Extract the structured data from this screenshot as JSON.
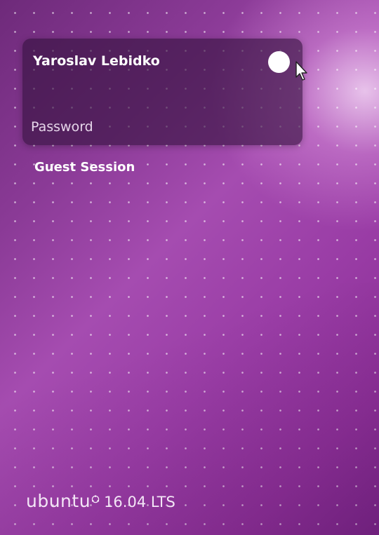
{
  "login": {
    "user_name": "Yaroslav Lebidko",
    "password_placeholder": "Password",
    "guest_session_label": "Guest Session"
  },
  "footer": {
    "logo_text": "ubuntu",
    "version": "16.04 LTS"
  },
  "icons": {
    "session_toggle": "white-circle-toggle",
    "cursor": "mouse-pointer-icon",
    "logo_mark": "ubuntu-circle-of-friends-icon"
  },
  "colors": {
    "background_purple": "#8a3a96",
    "card_background": "#34123e",
    "text": "#ffffff"
  }
}
